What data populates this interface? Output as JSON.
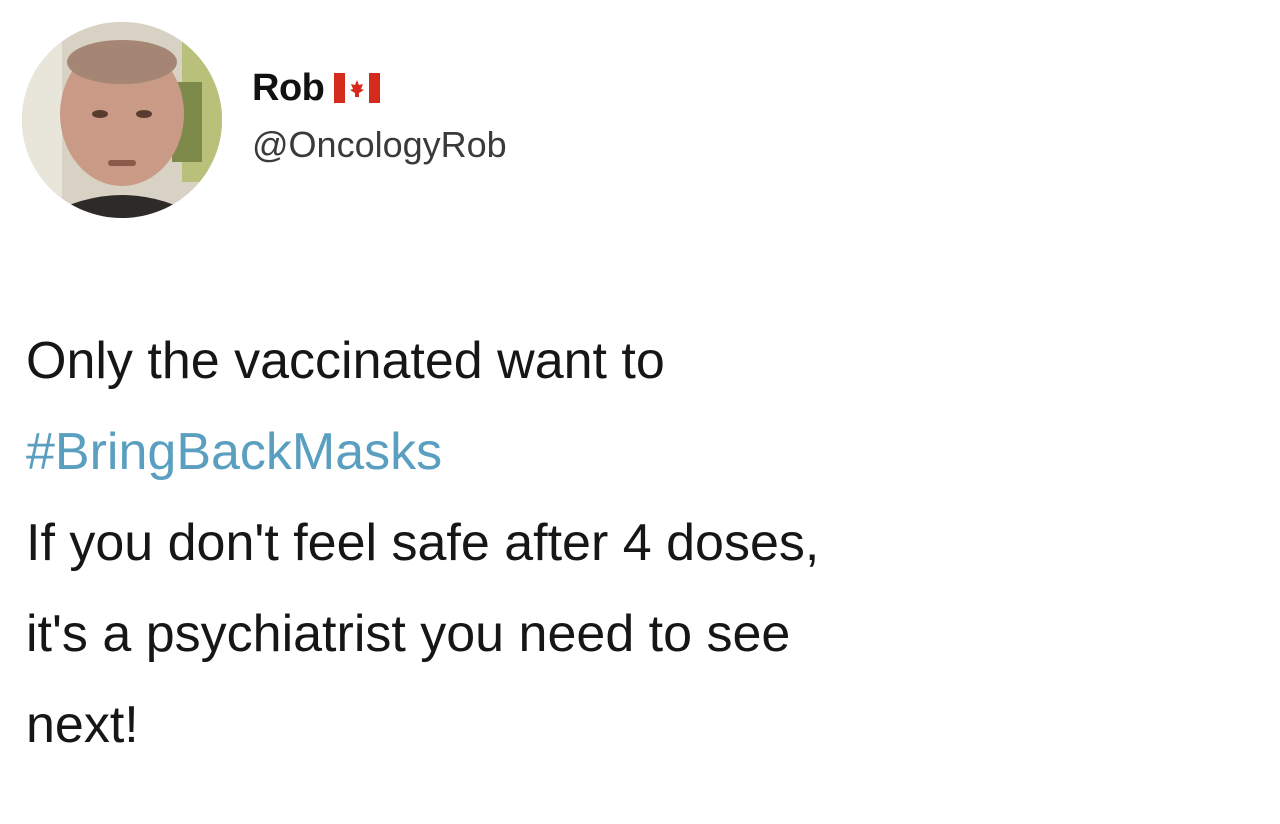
{
  "author": {
    "display_name": "Rob",
    "handle": "@OncologyRob",
    "flag_icon": "canada-flag-icon",
    "avatar_icon": "profile-photo"
  },
  "tweet": {
    "line1": "Only the vaccinated want to",
    "hashtag": "#BringBackMasks",
    "line3": "If you don't feel safe after 4 doses,",
    "line4": "it's a psychiatrist you need to see",
    "line5": "next!"
  },
  "colors": {
    "hashtag": "#5a9fc0",
    "text": "#161616",
    "flag_red": "#d52b1e"
  }
}
